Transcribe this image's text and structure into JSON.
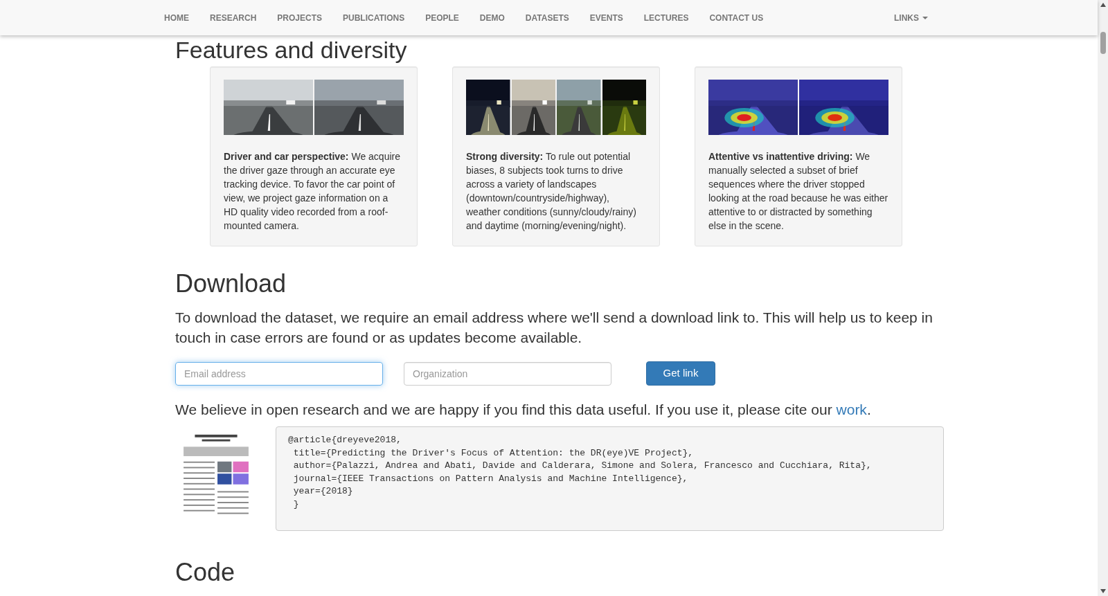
{
  "navbar": {
    "items": [
      {
        "label": "HOME"
      },
      {
        "label": "RESEARCH"
      },
      {
        "label": "PROJECTS"
      },
      {
        "label": "PUBLICATIONS"
      },
      {
        "label": "PEOPLE"
      },
      {
        "label": "DEMO"
      },
      {
        "label": "DATASETS"
      },
      {
        "label": "EVENTS"
      },
      {
        "label": "LECTURES"
      },
      {
        "label": "CONTACT US"
      }
    ],
    "dropdown": {
      "label": "LINKS"
    }
  },
  "features": {
    "heading": "Features and diversity",
    "cards": [
      {
        "title": "Driver and car perspective:",
        "text": "We acquire the driver gaze through an accurate eye tracking device. To favor the car point of view, we project gaze information on a HD quality video recorded from a roof-mounted camera."
      },
      {
        "title": "Strong diversity:",
        "text": "To rule out potential biases, 8 subjects took turns to drive across a variety of landscapes (downtown/countryside/highway), weather conditions (sunny/cloudy/rainy) and daytime (morning/evening/night)."
      },
      {
        "title": "Attentive vs inattentive driving:",
        "text": "We manually selected a subset of brief sequences where the driver stopped looking at the road because he was either attentive to or distracted by something else in the scene."
      }
    ]
  },
  "download": {
    "heading": "Download",
    "text": "To download the dataset, we require an email address where we'll send a download link to. This will help us to keep in touch in case errors are found or as updates become available.",
    "fields": [
      {
        "placeholder": "Email address",
        "focused": true
      },
      {
        "placeholder": "Organization",
        "focused": false
      }
    ],
    "button": "Get link",
    "cite_text": "We believe in open research and we are happy if you find this data useful. If you use it, please cite our",
    "cite_link": "work",
    "cite_end": ".",
    "bibtex": [
      "@article{dreyeve2018,",
      " title={Predicting the Driver's Focus of Attention: the DR(eye)VE Project},",
      " author={Palazzi, Andrea and Abati, Davide and Calderara, Simone and Solera, Francesco and Cucchiara, Rita},",
      " journal={IEEE Transactions on Pattern Analysis and Machine Intelligence},",
      " year={2018}",
      " }"
    ]
  },
  "code": {
    "heading": "Code"
  }
}
